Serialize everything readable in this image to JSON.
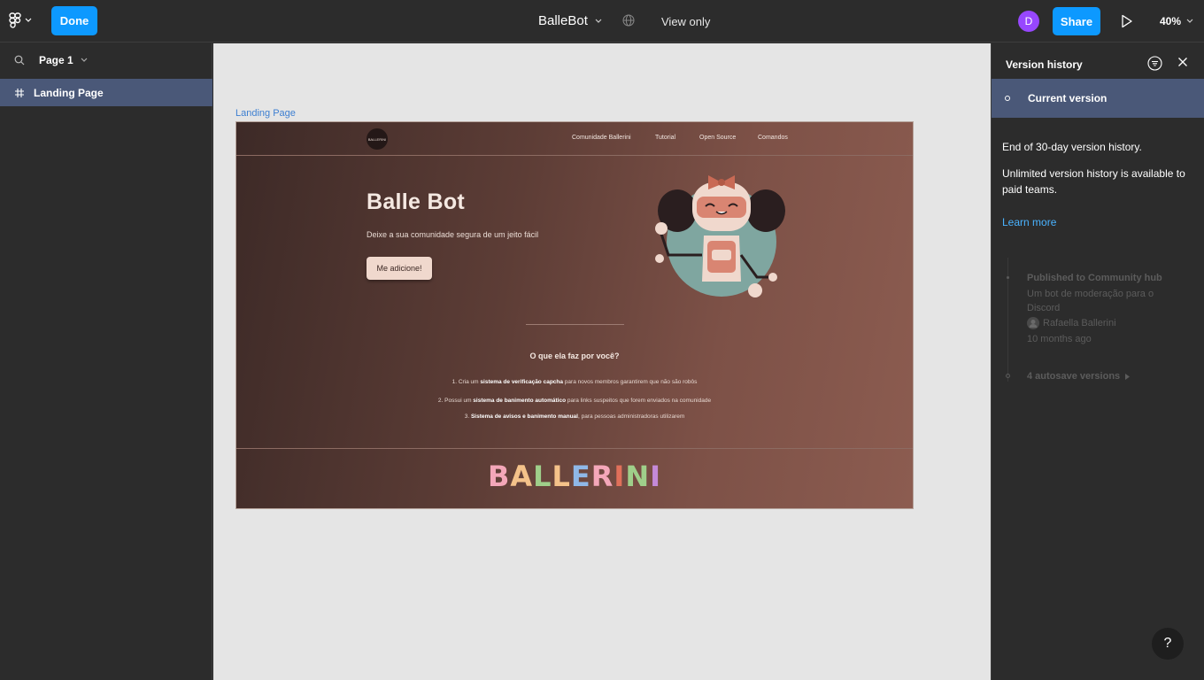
{
  "topbar": {
    "done_label": "Done",
    "file_title": "BalleBot",
    "view_only": "View only",
    "avatar_initial": "D",
    "share_label": "Share",
    "zoom": "40%",
    "accent_color": "#0d99ff"
  },
  "left": {
    "page_label": "Page 1",
    "layers": [
      {
        "label": "Landing Page",
        "icon": "frame-hash-icon"
      }
    ]
  },
  "canvas": {
    "frame_label": "Landing Page",
    "site": {
      "logo_text": "BALLERINI",
      "nav": [
        "Comunidade Ballerini",
        "Tutorial",
        "Open Source",
        "Comandos"
      ],
      "hero_title": "Balle Bot",
      "hero_subtitle": "Deixe a sua comunidade segura de um jeito fácil",
      "hero_button": "Me adicione!",
      "features_title": "O que ela faz por você?",
      "features": [
        {
          "pre": "1. Cria um ",
          "bold": "sistema de verificação capcha",
          "post": " para novos membros garantirem que não são robôs"
        },
        {
          "pre": "2. Possui um ",
          "bold": "sistema de banimento automático",
          "post": " para links suspeitos que forem enviados na comunidade"
        },
        {
          "pre": "3. ",
          "bold": "Sistema de avisos e banimento manual",
          "post": ", para pessoas administradoras utilizarem"
        }
      ],
      "footer_brand": "BALLERINI",
      "footer_letter_colors": [
        "#f4a7b9",
        "#f4c28a",
        "#9fcf8a",
        "#f4c28a",
        "#8fb8e8",
        "#f4a7b9",
        "#e0705a",
        "#9fcf8a",
        "#c48ad8"
      ]
    }
  },
  "version_history": {
    "title": "Version history",
    "current_version": "Current version",
    "end_text": "End of 30-day version history.",
    "unlimited_text": "Unlimited version history is available to paid teams.",
    "learn_more": "Learn more",
    "published_title": "Published to Community hub",
    "published_desc": "Um bot de moderação para o Discord",
    "author": "Rafaella Ballerini",
    "time_ago": "10 months ago",
    "autosave": "4 autosave versions"
  },
  "help_label": "?"
}
